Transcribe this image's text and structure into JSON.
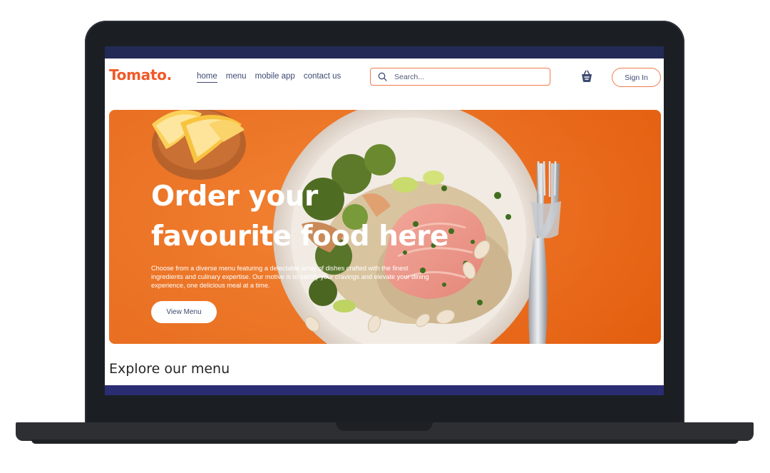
{
  "brand": {
    "logo_text": "Tomato.",
    "accent_color": "#f05a28",
    "nav_text_color": "#3e4a72"
  },
  "nav": {
    "items": [
      {
        "label": "home",
        "active": true
      },
      {
        "label": "menu",
        "active": false
      },
      {
        "label": "mobile app",
        "active": false
      },
      {
        "label": "contact us",
        "active": false
      }
    ]
  },
  "search": {
    "placeholder": "Search...",
    "icon": "search-icon"
  },
  "cart": {
    "icon": "basket-icon"
  },
  "auth": {
    "signin_label": "Sign In"
  },
  "hero": {
    "title": "Order your favourite food here",
    "description": "Choose from a diverse menu featuring a delectable array of dishes crafted with the finest ingredients and culinary expertise. Our motive is to satisfy your cravings and elevate your dining experience, one delicious meal at a time.",
    "cta_label": "View Menu",
    "background_color": "#f07a2c"
  },
  "section": {
    "explore_title": "Explore our menu"
  }
}
